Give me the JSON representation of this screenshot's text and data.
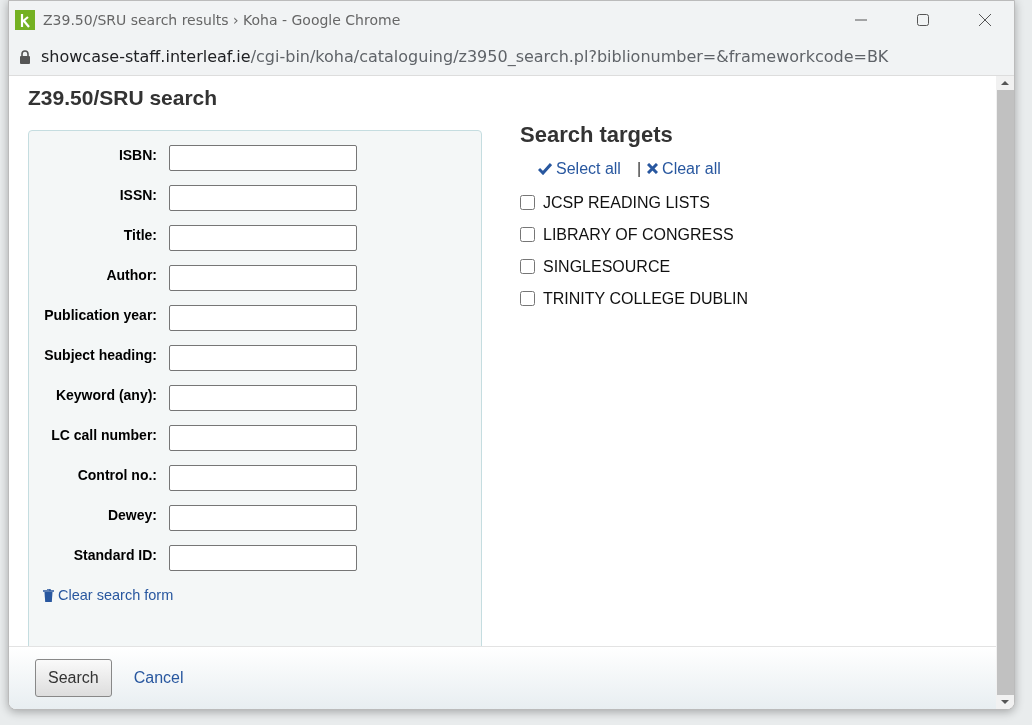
{
  "window": {
    "title": "Z39.50/SRU search results › Koha - Google Chrome"
  },
  "address_bar": {
    "host": "showcase-staff.interleaf.ie",
    "path": "/cgi-bin/koha/cataloguing/z3950_search.pl?biblionumber=&frameworkcode=BK"
  },
  "heading": "Z39.50/SRU search",
  "fields": [
    {
      "label": "ISBN:"
    },
    {
      "label": "ISSN:"
    },
    {
      "label": "Title:"
    },
    {
      "label": "Author:"
    },
    {
      "label": "Publication year:"
    },
    {
      "label": "Subject heading:"
    },
    {
      "label": "Keyword (any):"
    },
    {
      "label": "LC call number:"
    },
    {
      "label": "Control no.:"
    },
    {
      "label": "Dewey:"
    },
    {
      "label": "Standard ID:"
    }
  ],
  "clear_form_link": "Clear search form",
  "targets": {
    "title": "Search targets",
    "select_all": "Select all",
    "separator": "|",
    "clear_all": "Clear all",
    "items": [
      {
        "label": "JCSP READING LISTS",
        "checked": false
      },
      {
        "label": "LIBRARY OF CONGRESS",
        "checked": false
      },
      {
        "label": "SINGLESOURCE",
        "checked": false
      },
      {
        "label": "TRINITY COLLEGE DUBLIN",
        "checked": false
      }
    ]
  },
  "buttons": {
    "search": "Search",
    "cancel": "Cancel"
  }
}
